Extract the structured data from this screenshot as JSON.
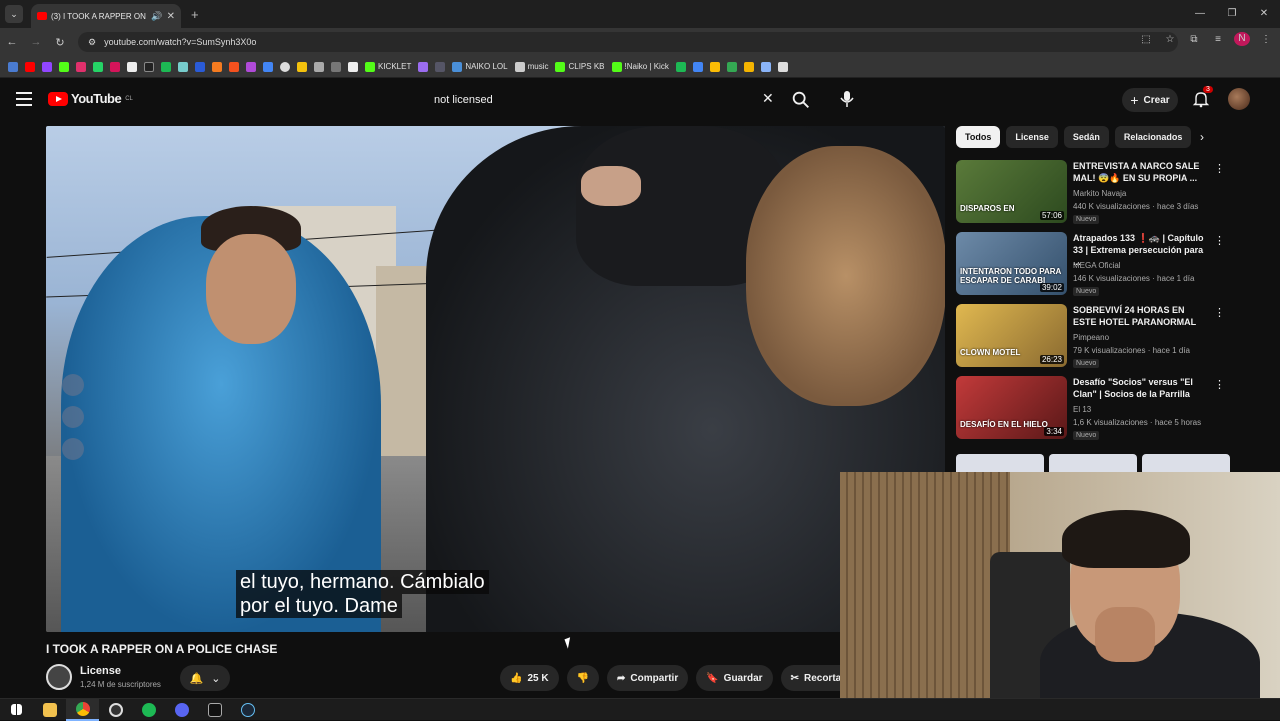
{
  "browser": {
    "tab_title": "(3) I TOOK A RAPPER ON A",
    "url": "youtube.com/watch?v=SumSynh3X0o",
    "new_tab": "+",
    "window_min": "—",
    "window_max": "❐",
    "window_close": "✕",
    "profile_initial": "N"
  },
  "bookmarks": [
    "KICKLET",
    "NAIKO LOL",
    "music",
    "CLIPS KB",
    "!Naiko | Kick"
  ],
  "youtube": {
    "logo_text": "YouTube",
    "logo_region": "CL",
    "search_value": "not licensed",
    "create_label": "Crear",
    "notification_count": "3"
  },
  "video": {
    "subtitle_line1": "el tuyo, hermano.  Cámbialo",
    "subtitle_line2": "por el tuyo.  Dame",
    "title": "I TOOK A RAPPER ON A POLICE CHASE",
    "channel": "License",
    "subscribers": "1,24 M de suscriptores",
    "likes": "25 K",
    "share_label": "Compartir",
    "save_label": "Guardar",
    "clip_label": "Recortar"
  },
  "chips": [
    "Todos",
    "License",
    "Sedán",
    "Relacionados"
  ],
  "recommendations": [
    {
      "title": "ENTREVISTA A NARCO SALE MAL! 😨🔥 EN SU PROPIA ...",
      "channel": "Markito Navaja",
      "meta": "440 K visualizaciones · hace 3 días",
      "badge": "Nuevo",
      "duration": "57:06",
      "thumb_text": "DISPAROS EN",
      "thumb_color": "#3d6b2f"
    },
    {
      "title": "Atrapados 133 ❗🚓 | Capítulo 33 | Extrema persecución para ...",
      "channel": "MEGA Oficial",
      "meta": "146 K visualizaciones · hace 1 día",
      "badge": "Nuevo",
      "duration": "39:02",
      "thumb_text": "INTENTARON TODO PARA ESCAPAR DE CARABI",
      "thumb_color": "#4a6a88"
    },
    {
      "title": "SOBREVIVÍ 24 HORAS EN ESTE HOTEL PARANORMAL",
      "channel": "Pimpeano",
      "meta": "79 K visualizaciones · hace 1 día",
      "badge": "Nuevo",
      "duration": "26:23",
      "thumb_text": "CLOWN MOTEL",
      "thumb_color": "#c89a3a"
    },
    {
      "title": "Desafío \"Socios\" versus \"El Clan\" | Socios de la Parrilla",
      "channel": "El 13",
      "meta": "1,6 K visualizaciones · hace 5 horas",
      "badge": "Nuevo",
      "duration": "3:34",
      "thumb_text": "DESAFÍO EN EL HIELO",
      "thumb_color": "#a8262a"
    }
  ]
}
